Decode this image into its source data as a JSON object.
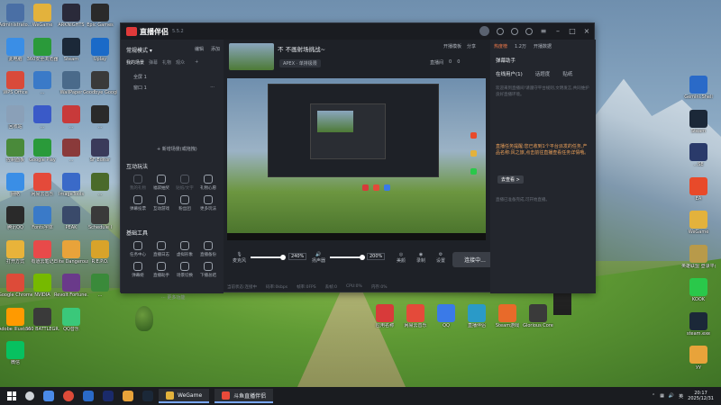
{
  "desktop": {
    "icons_left": [
      {
        "label": "Administrato...",
        "color": "#4a6fa5"
      },
      {
        "label": "此电脑",
        "color": "#3a8ee6"
      },
      {
        "label": "WPS Office",
        "color": "#d94a3a"
      },
      {
        "label": "回收站",
        "color": "#8aa0b8"
      },
      {
        "label": "控制面板",
        "color": "#4a8a3a"
      },
      {
        "label": "网络",
        "color": "#3a8ee6"
      },
      {
        "label": "腾讯QQ",
        "color": "#2a2a2a"
      },
      {
        "label": "打开方式",
        "color": "#e8b33a"
      },
      {
        "label": "Google Chrome",
        "color": "#dd4b39"
      },
      {
        "label": "Adobe Illustrat...",
        "color": "#ff9a00"
      },
      {
        "label": "微信",
        "color": "#07c160"
      }
    ],
    "icons_col2": [
      {
        "label": "WeGame",
        "color": "#e3b23c"
      },
      {
        "label": "360安全浏览器",
        "color": "#2a9a3a"
      },
      {
        "label": "...",
        "color": "#3a7ac8"
      },
      {
        "label": "...",
        "color": "#3a5ac8"
      },
      {
        "label": "Google Play",
        "color": "#2a9a3a"
      },
      {
        "label": "网易云音乐",
        "color": "#e44a3a"
      },
      {
        "label": "Fonts字体",
        "color": "#3a7ac8"
      },
      {
        "label": "有道云笔记",
        "color": "#e84a4a"
      },
      {
        "label": "NVIDIA",
        "color": "#76b900"
      },
      {
        "label": "360 BATTLEGR...",
        "color": "#3a3a3a"
      }
    ],
    "icons_col3": [
      {
        "label": "ARKNIGHTS",
        "color": "#2a2a3a"
      },
      {
        "label": "Steam",
        "color": "#1b2838"
      },
      {
        "label": "WallPaper",
        "color": "#4a6a8a"
      },
      {
        "label": "...",
        "color": "#c83a3a"
      },
      {
        "label": "...",
        "color": "#8a3a3a"
      },
      {
        "label": "ImageTools",
        "color": "#3a6ac8"
      },
      {
        "label": "PEAK",
        "color": "#3a4a6a"
      },
      {
        "label": "Elite Dangerous",
        "color": "#e8a33a"
      },
      {
        "label": "Revolt Fortune...",
        "color": "#6a3a8a"
      },
      {
        "label": "QQ音乐",
        "color": "#3ac87a"
      }
    ],
    "icons_col4": [
      {
        "label": "Epic Games",
        "color": "#2a2a2a"
      },
      {
        "label": "Uplay",
        "color": "#1a6ac8"
      },
      {
        "label": "Goodbye Google...",
        "color": "#3a3a3a"
      },
      {
        "label": "...",
        "color": "#2a2a2a"
      },
      {
        "label": "SF Editor",
        "color": "#3a3a5a"
      },
      {
        "label": "...",
        "color": "#4a6a2a"
      },
      {
        "label": "Schedule I",
        "color": "#3a3a3a"
      },
      {
        "label": "R.E.P.O.",
        "color": "#d8a32a"
      },
      {
        "label": "...",
        "color": "#3a8a3a"
      }
    ],
    "icons_right": [
      {
        "label": "Gemini.Shell",
        "color": "#2a6ac8"
      },
      {
        "label": "Steam",
        "color": "#1b2838"
      },
      {
        "label": "...SE",
        "color": "#2a3a6a"
      },
      {
        "label": "EA",
        "color": "#e84a2a"
      },
      {
        "label": "WeGame",
        "color": "#e3b23c"
      },
      {
        "label": "英雄联盟 登录平台",
        "color": "#b89a4a"
      },
      {
        "label": "KOOK",
        "color": "#2ac84a"
      },
      {
        "label": "steam.exe",
        "color": "#1b2838"
      },
      {
        "label": "yy",
        "color": "#e8a33a"
      }
    ],
    "icons_bottom": [
      {
        "label": "应用名称",
        "color": "#d83a3a"
      },
      {
        "label": "网易云音乐",
        "color": "#e44a3a"
      },
      {
        "label": "QQ",
        "color": "#3a7ae8"
      },
      {
        "label": "直播伴侣",
        "color": "#2a9ac8"
      },
      {
        "label": "Steam游戏",
        "color": "#e86a2a"
      },
      {
        "label": "Glorious Core",
        "color": "#3a3a3a"
      }
    ]
  },
  "app": {
    "title": "直播伴侣",
    "version": "5.5.2",
    "left": {
      "mode": "常规模式",
      "mode_actions": [
        "编辑",
        "添加"
      ],
      "tabs": [
        "我的场景",
        "弹幕",
        "礼物",
        "观众"
      ],
      "scenes": [
        {
          "name": "全屏 1",
          "extra": ""
        },
        {
          "name": "窗口 1",
          "extra": "···"
        }
      ],
      "add_scene": "+ 新增场景(或拖拽)",
      "interactive_title": "互动玩法",
      "interactive_tools": [
        {
          "label": "我的礼物",
          "dim": true
        },
        {
          "label": "福袋抽奖",
          "dim": false
        },
        {
          "label": "贴纸/文字",
          "dim": true
        },
        {
          "label": "礼物心愿",
          "dim": false
        },
        {
          "label": "弹幕投票",
          "dim": false
        },
        {
          "label": "互动游戏",
          "dim": false
        },
        {
          "label": "粉丝团",
          "dim": false
        },
        {
          "label": "更多玩法",
          "dim": false
        }
      ],
      "basic_title": "基础工具",
      "basic_tools": [
        {
          "label": "任务中心",
          "dim": false
        },
        {
          "label": "直播日志",
          "dim": false
        },
        {
          "label": "虚拟形象",
          "dim": false
        },
        {
          "label": "直播备份",
          "dim": false
        },
        {
          "label": "弹幕姬",
          "dim": false
        },
        {
          "label": "直播助手",
          "dim": false
        },
        {
          "label": "场景切换",
          "dim": false
        },
        {
          "label": "下播总结",
          "dim": false
        }
      ],
      "more": "··· 更多功能"
    },
    "center": {
      "stream_title": "不 不画射场挑战~",
      "category": "APEX · 单排极限",
      "top_actions": [
        "开播模板",
        "分享"
      ],
      "top_actions2": [
        "直播间",
        "0",
        "0"
      ],
      "controls": [
        {
          "label": "麦克风"
        },
        {
          "label": "扬声器"
        },
        {
          "label": "美颜"
        },
        {
          "label": "录制"
        },
        {
          "label": "设置"
        }
      ],
      "mic_pct": "240%",
      "speaker_pct": "200%",
      "live_button": "连接中...",
      "status": [
        "当前状态:连接中",
        "码率:0kbps",
        "帧率:0FPS",
        "丢帧:0",
        "CPU:0%",
        "内存:0%"
      ]
    },
    "right": {
      "top": [
        "热度榜",
        "1.2万",
        "开播数据"
      ],
      "assist_title": "弹幕助手",
      "assist_tabs": [
        "在线用户(1)",
        "话题度",
        "贴纸"
      ],
      "msg1": "欢迎来到直播间!请遵守平台规则,文明发言,共同维护良好直播环境。",
      "alert": "直播任务提醒:您已收到1个平台派发的任务,产品名称:风之旅,点击前往直播查看任务详情哦。",
      "go_button": "去查看 >",
      "msg2": "直播已准备完成,可开始直播。"
    }
  },
  "taskbar": {
    "tasks": [
      {
        "label": "WeGame",
        "color": "#e3b23c"
      },
      {
        "label": "斗鱼直播伴侣",
        "color": "#e84a3a"
      }
    ],
    "time": "20:17",
    "date": "2025/12/31"
  }
}
